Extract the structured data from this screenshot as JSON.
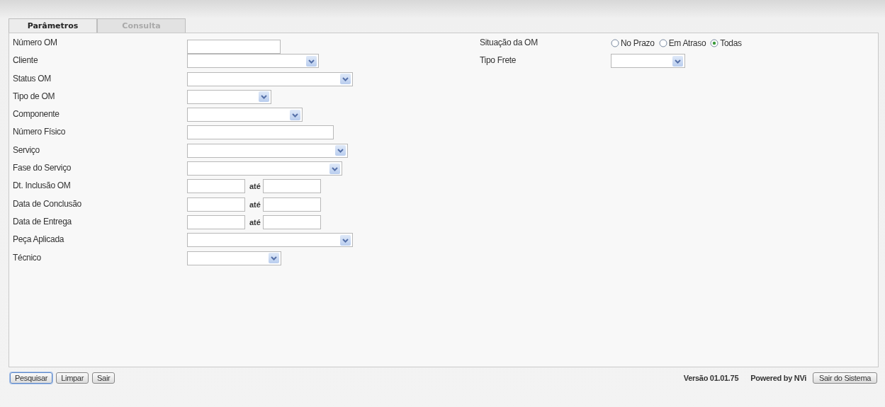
{
  "tabs": [
    {
      "label": "Parâmetros",
      "selected": true
    },
    {
      "label": "Consulta",
      "selected": false
    }
  ],
  "left_fields": [
    {
      "label": "Número OM",
      "kind": "text"
    },
    {
      "label": "Cliente",
      "kind": "select"
    },
    {
      "label": "Status OM",
      "kind": "select"
    },
    {
      "label": "Tipo de OM",
      "kind": "select"
    },
    {
      "label": "Componente",
      "kind": "select"
    },
    {
      "label": "Número Físico",
      "kind": "text"
    },
    {
      "label": "Serviço",
      "kind": "select"
    },
    {
      "label": "Fase do Serviço",
      "kind": "select"
    },
    {
      "label": "Dt. Inclusão OM",
      "kind": "range",
      "separator": "até"
    },
    {
      "label": "Data de Conclusão",
      "kind": "range",
      "separator": "até"
    },
    {
      "label": "Data de Entrega",
      "kind": "range",
      "separator": "até"
    },
    {
      "label": "Peça Aplicada",
      "kind": "select"
    },
    {
      "label": "Técnico",
      "kind": "select"
    }
  ],
  "right_fields": [
    {
      "label": "Situação da OM",
      "kind": "radio",
      "options": [
        {
          "label": "No Prazo",
          "selected": false
        },
        {
          "label": "Em Atraso",
          "selected": false
        },
        {
          "label": "Todas",
          "selected": true
        }
      ]
    },
    {
      "label": "Tipo Frete",
      "kind": "select"
    }
  ],
  "buttons": [
    {
      "label": "Pesquisar",
      "focused": true
    },
    {
      "label": "Limpar",
      "focused": false
    },
    {
      "label": "Sair",
      "focused": false
    }
  ],
  "footer": {
    "version": "Versão 01.01.75",
    "powered": "Powered by NVi",
    "exit_button": "Sair do Sistema"
  }
}
